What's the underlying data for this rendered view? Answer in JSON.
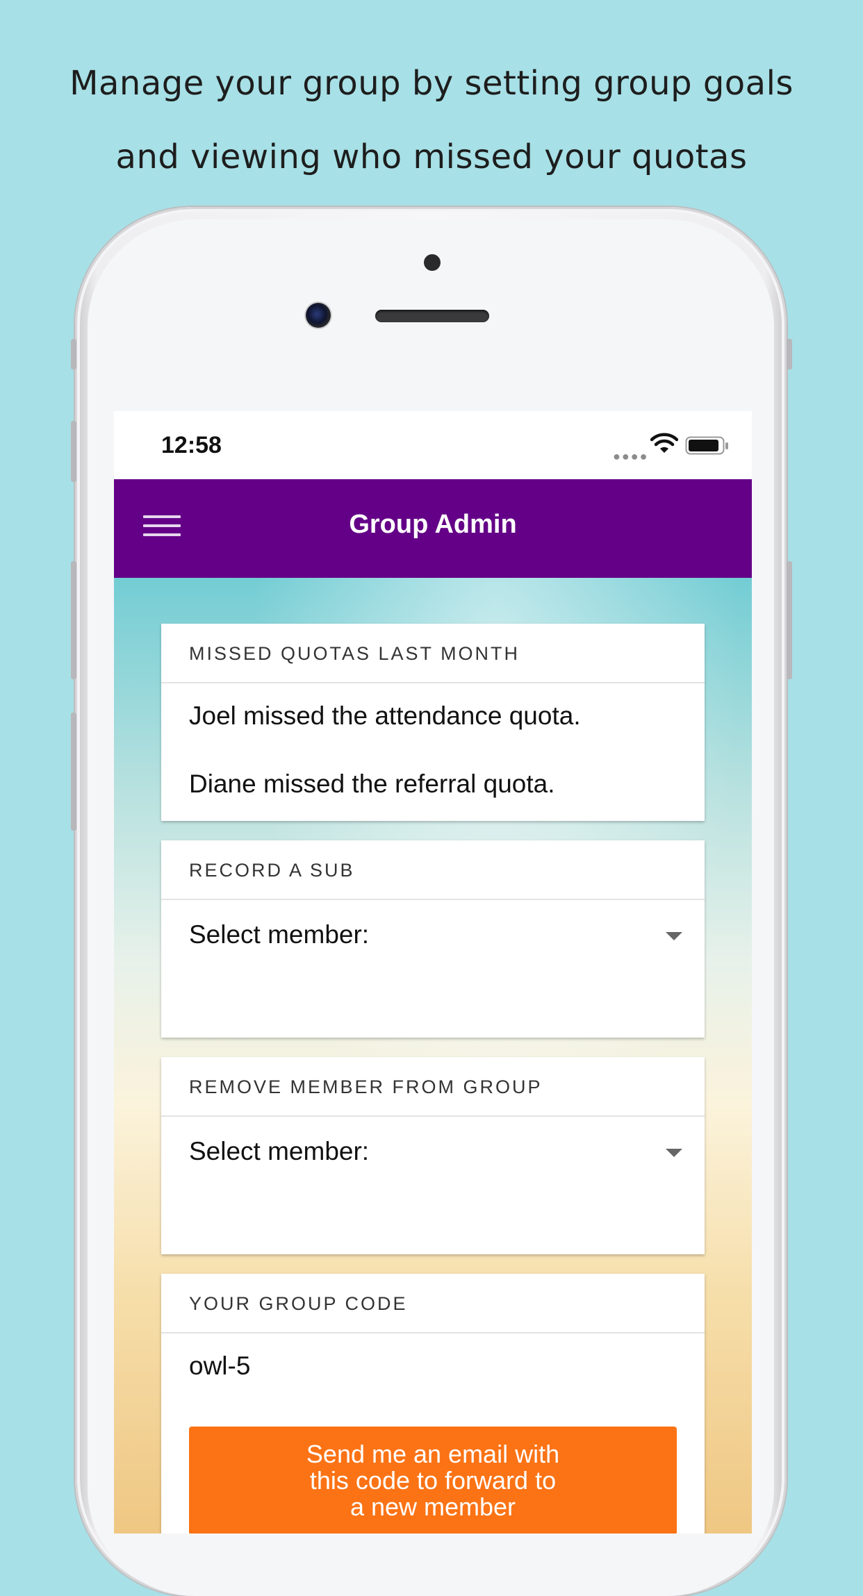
{
  "caption": {
    "line1": "Manage your group by setting group goals",
    "line2": "and viewing who missed your quotas"
  },
  "status_bar": {
    "time": "12:58"
  },
  "app_bar": {
    "title": "Group Admin",
    "menu_icon": "hamburger-icon",
    "color": "#640087"
  },
  "missed_quotas": {
    "header": "MISSED QUOTAS LAST MONTH",
    "items": [
      "Joel missed the attendance quota.",
      "Diane missed the referral quota."
    ]
  },
  "record_sub": {
    "header": "RECORD A SUB",
    "select_value": "Select member:"
  },
  "remove_member": {
    "header": "REMOVE MEMBER FROM GROUP",
    "select_value": "Select member:"
  },
  "group_code": {
    "header": "YOUR GROUP CODE",
    "code": "owl-5",
    "email_button": "Send me an email with\nthis code to forward to\na new member",
    "button_color": "#fb7315"
  }
}
